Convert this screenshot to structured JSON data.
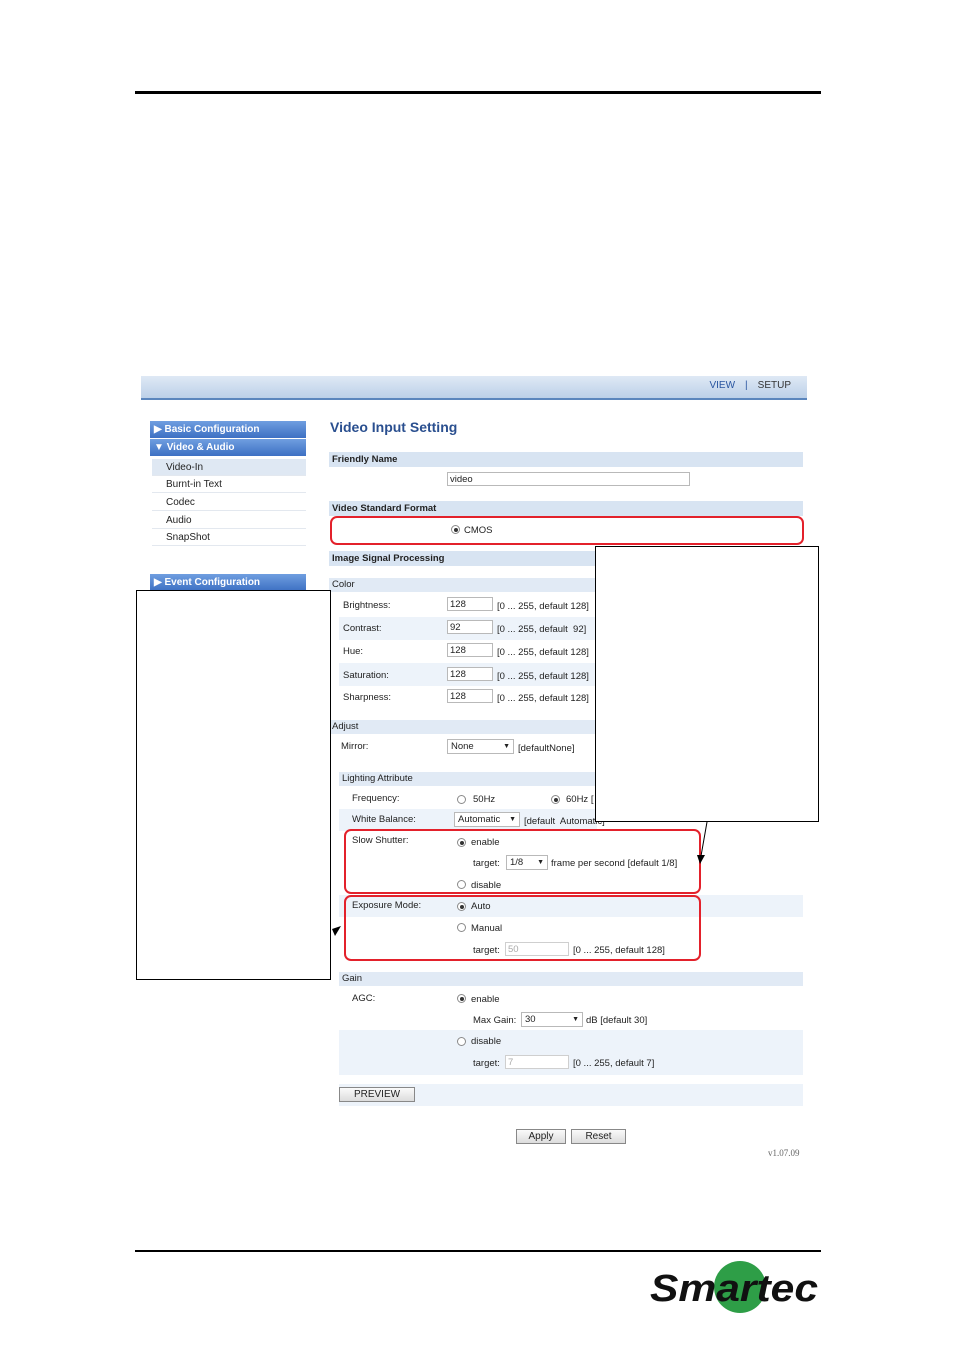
{
  "topbar": {
    "view": "VIEW",
    "separator": "|",
    "setup": "SETUP"
  },
  "sidebar": {
    "basic": "Basic Configuration",
    "video_audio": "Video & Audio",
    "items": [
      "Video-In",
      "Burnt-in Text",
      "Codec",
      "Audio",
      "SnapShot"
    ],
    "event": "Event Configuration",
    "collapsed_arrow": "▶",
    "expanded_arrow": "▼"
  },
  "page_title": "Video Input Setting",
  "friendly_name": {
    "header": "Friendly Name",
    "value": "video"
  },
  "video_standard": {
    "header": "Video Standard Format",
    "option": "CMOS"
  },
  "isp": {
    "header": "Image Signal Processing"
  },
  "color": {
    "header": "Color",
    "rows": [
      {
        "label": "Brightness:",
        "value": "128",
        "range": "[0 ... 255, default 128]"
      },
      {
        "label": "Contrast:",
        "value": "92",
        "range": "[0 ... 255, default  92]"
      },
      {
        "label": "Hue:",
        "value": "128",
        "range": "[0 ... 255, default 128]"
      },
      {
        "label": "Saturation:",
        "value": "128",
        "range": "[0 ... 255, default 128]"
      },
      {
        "label": "Sharpness:",
        "value": "128",
        "range": "[0 ... 255, default 128]"
      }
    ]
  },
  "adjust": {
    "header": "Adjust",
    "mirror_label": "Mirror:",
    "mirror_value": "None",
    "mirror_default": "[defaultNone]"
  },
  "lighting": {
    "header": "Lighting Attribute",
    "frequency_label": "Frequency:",
    "freq_50": "50Hz",
    "freq_60": "60Hz [",
    "wb_label": "White Balance:",
    "wb_value": "Automatic",
    "wb_default": "[default  Automatic]",
    "slow_label": "Slow Shutter:",
    "slow_enable": "enable",
    "slow_target_label": "target:",
    "slow_target_value": "1/8",
    "slow_target_note": "frame per second [default 1/8]",
    "slow_disable": "disable",
    "exposure_label": "Exposure Mode:",
    "exp_auto": "Auto",
    "exp_manual": "Manual",
    "exp_target_label": "target:",
    "exp_target_value": "50",
    "exp_target_note": "[0 ... 255, default 128]"
  },
  "gain": {
    "header": "Gain",
    "agc_label": "AGC:",
    "enable": "enable",
    "max_gain_label": "Max Gain:",
    "max_gain_value": "30",
    "max_gain_note": "dB [default 30]",
    "disable": "disable",
    "target_label": "target:",
    "target_value": "7",
    "target_note": "[0 ... 255, default 7]"
  },
  "buttons": {
    "preview": "PREVIEW",
    "apply": "Apply",
    "reset": "Reset"
  },
  "version": "v1.07.09",
  "logo": "Smartec",
  "colors": {
    "accent": "#2955a0",
    "highlight": "#e3212b",
    "logo_green": "#2e9e47"
  }
}
